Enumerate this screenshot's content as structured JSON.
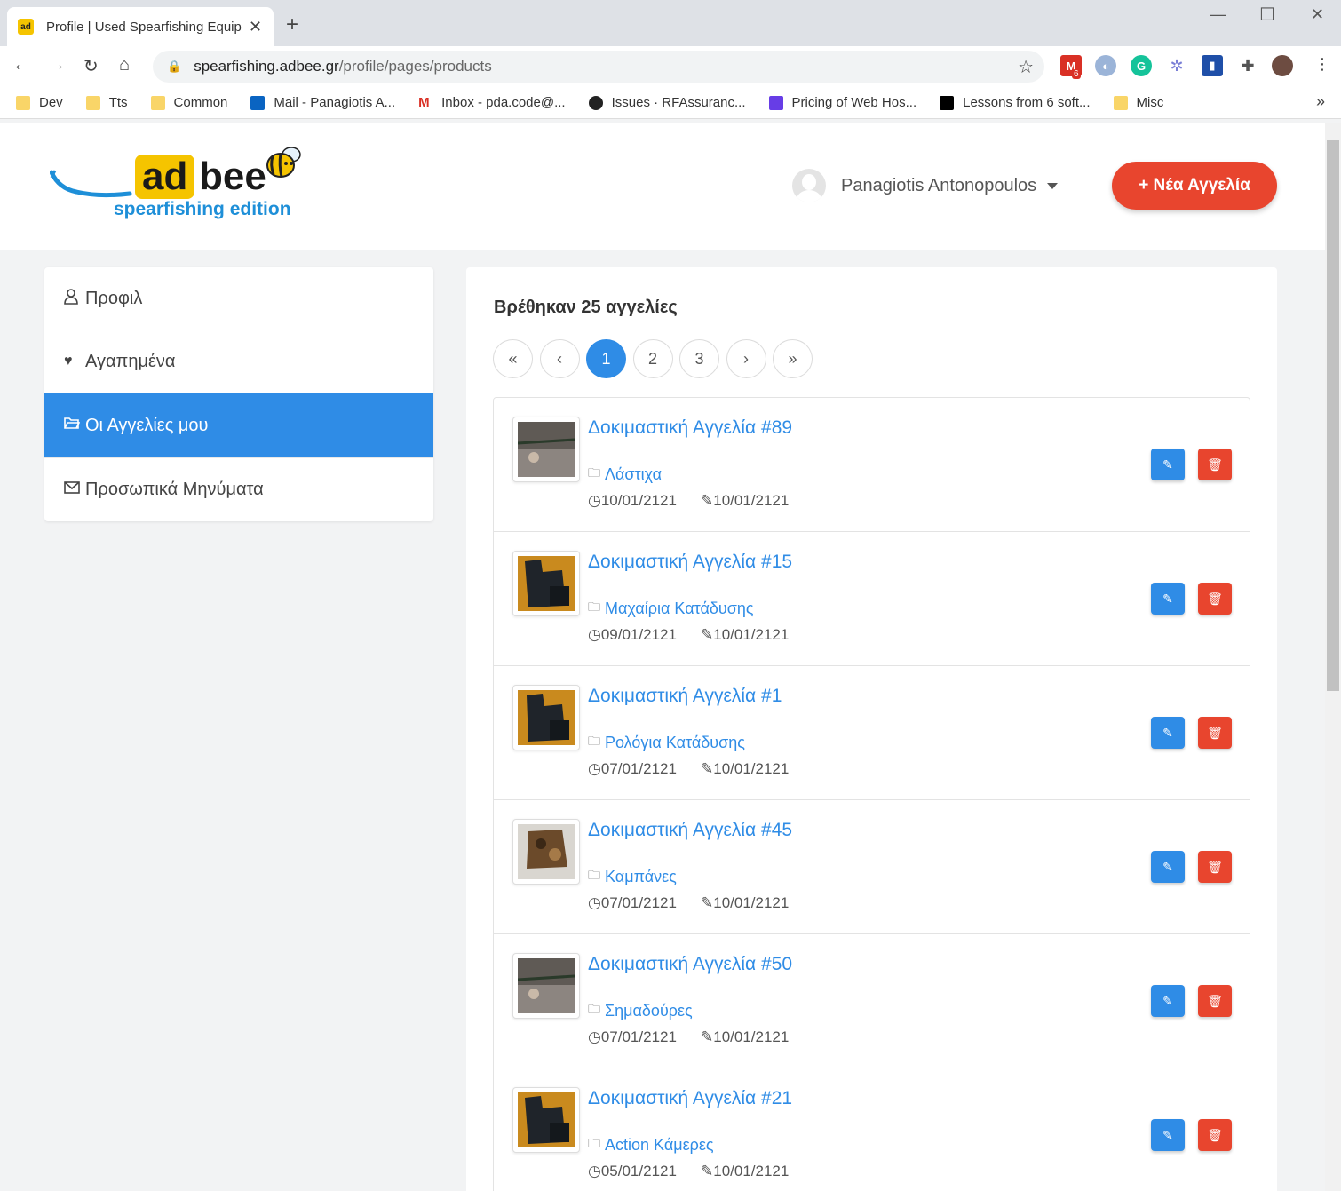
{
  "browser": {
    "tab_title": "Profile | Used Spearfishing Equipment",
    "favicon_text": "ad",
    "url_domain": "spearfishing.adbee.gr",
    "url_path": "/profile/pages/products",
    "gmail_badge": "6",
    "bookmarks": [
      {
        "label": "Dev",
        "icon": "folder-icon"
      },
      {
        "label": "Tts",
        "icon": "folder-icon"
      },
      {
        "label": "Common",
        "icon": "folder-icon"
      },
      {
        "label": "Mail - Panagiotis A...",
        "icon": "outlook-icon"
      },
      {
        "label": "Inbox - pda.code@...",
        "icon": "gmail-icon"
      },
      {
        "label": "Issues · RFAssuranc...",
        "icon": "github-icon"
      },
      {
        "label": "Pricing of Web Hos...",
        "icon": "hostinger-icon"
      },
      {
        "label": "Lessons from 6 soft...",
        "icon": "medium-icon"
      },
      {
        "label": "Misc",
        "icon": "folder-icon"
      }
    ]
  },
  "header": {
    "logo_ad": "ad",
    "logo_bee": "bee",
    "logo_sub": "spearfishing edition",
    "user_name": "Panagiotis Antonopoulos",
    "new_ad_label": "+ Νέα Αγγελία"
  },
  "sidebar": {
    "items": [
      {
        "label": "Προφιλ",
        "icon": "user-icon"
      },
      {
        "label": "Αγαπημένα",
        "icon": "heart-icon"
      },
      {
        "label": "Οι Αγγελίες μου",
        "icon": "folder-open-icon",
        "active": true
      },
      {
        "label": "Προσωπικά Μηνύματα",
        "icon": "envelope-icon"
      }
    ]
  },
  "main": {
    "found_text": "Βρέθηκαν 25 αγγελίες",
    "pagination": [
      "«",
      "‹",
      "1",
      "2",
      "3",
      "›",
      "»"
    ],
    "current_page": "1",
    "ads": [
      {
        "title": "Δοκιμαστική Αγγελία #89",
        "category": "Λάστιχα",
        "created": "10/01/2121",
        "edited": "10/01/2121"
      },
      {
        "title": "Δοκιμαστική Αγγελία #15",
        "category": "Μαχαίρια Κατάδυσης",
        "created": "09/01/2121",
        "edited": "10/01/2121"
      },
      {
        "title": "Δοκιμαστική Αγγελία #1",
        "category": "Ρολόγια Κατάδυσης",
        "created": "07/01/2121",
        "edited": "10/01/2121"
      },
      {
        "title": "Δοκιμαστική Αγγελία #45",
        "category": "Καμπάνες",
        "created": "07/01/2121",
        "edited": "10/01/2121"
      },
      {
        "title": "Δοκιμαστική Αγγελία #50",
        "category": "Σημαδούρες",
        "created": "07/01/2121",
        "edited": "10/01/2121"
      },
      {
        "title": "Δοκιμαστική Αγγελία #21",
        "category": "Action Κάμερες",
        "created": "05/01/2121",
        "edited": "10/01/2121"
      }
    ]
  },
  "colors": {
    "primary": "#2f8ce6",
    "danger": "#e8452e",
    "brand_yellow": "#f5c400"
  }
}
